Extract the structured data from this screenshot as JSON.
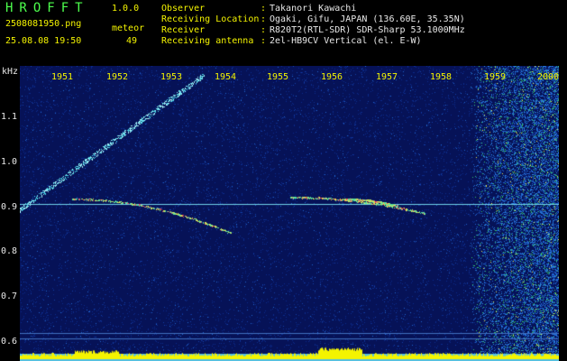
{
  "app": {
    "name": "HROFFT",
    "version": "1.0.0"
  },
  "file_name": "2508081950.png",
  "meteor_label": "meteor",
  "date_time": "25.08.08 19:50",
  "meteor_count": "49",
  "info": [
    {
      "label": "Observer",
      "value": "Takanori Kawachi"
    },
    {
      "label": "Receiving Location",
      "value": "Ogaki, Gifu, JAPAN (136.60E, 35.35N)"
    },
    {
      "label": "Receiver",
      "value": "R820T2(RTL-SDR) SDR-Sharp 53.1000MHz"
    },
    {
      "label": "Receiving antenna",
      "value": "2el-HB9CV Vertical (el. E-W)"
    }
  ],
  "y_axis": {
    "unit": "kHz",
    "ticks": [
      "1.1",
      "1.0",
      "0.9",
      "0.8",
      "0.7",
      "0.6"
    ]
  },
  "x_axis": {
    "ticks": [
      "1951",
      "1952",
      "1953",
      "1954",
      "1955",
      "1956",
      "1957",
      "1958",
      "1959",
      "2000"
    ]
  }
}
